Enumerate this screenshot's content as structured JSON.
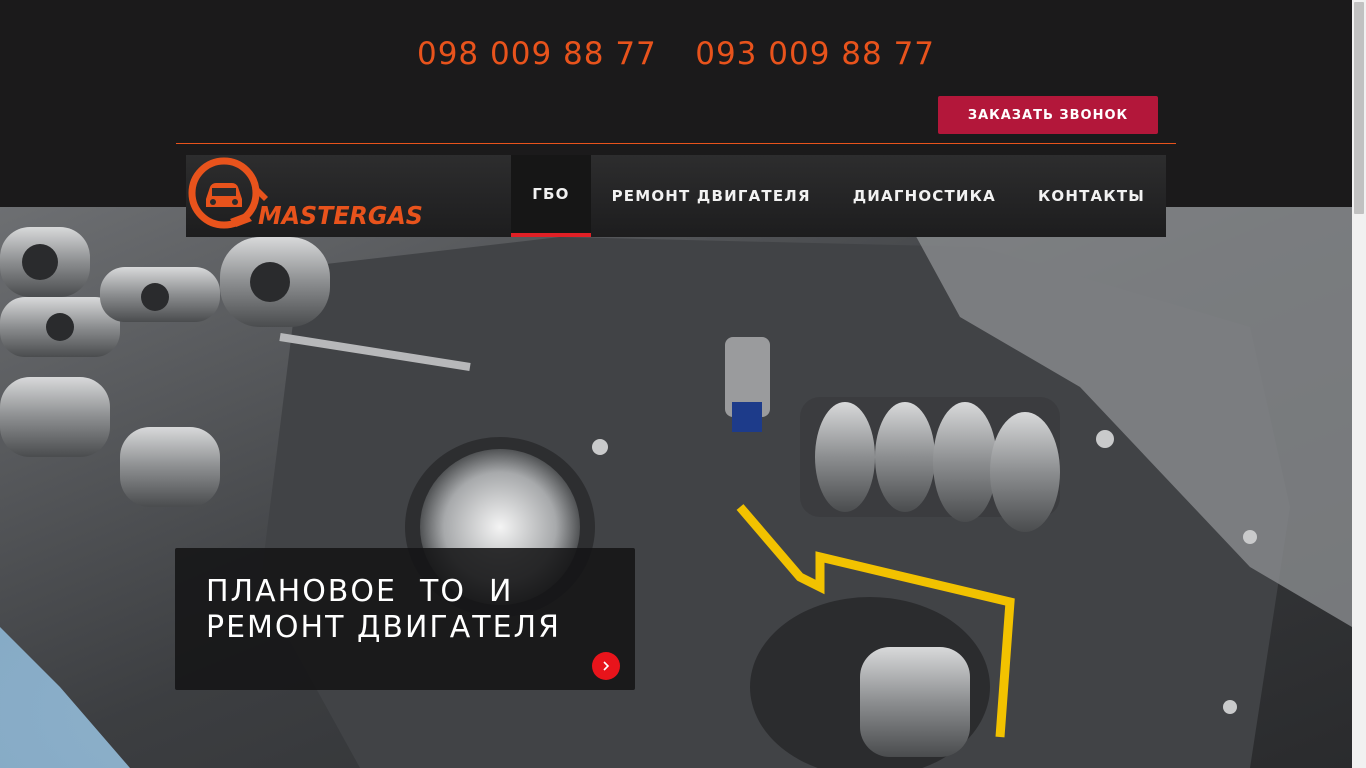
{
  "header": {
    "phones": [
      "098 009 88 77",
      "093 009 88 77"
    ],
    "call_button": "ЗАКАЗАТЬ ЗВОНОК"
  },
  "logo": {
    "text": "MASTERGAS",
    "icon": "car-wrench-icon"
  },
  "nav": {
    "items": [
      {
        "label": "ГБО",
        "active": true
      },
      {
        "label": "РЕМОНТ ДВИГАТЕЛЯ",
        "active": false
      },
      {
        "label": "ДИАГНОСТИКА",
        "active": false
      },
      {
        "label": "КОНТАКТЫ",
        "active": false
      }
    ]
  },
  "slide": {
    "title_line1": "ПЛАНОВОЕ  ТО  И",
    "title_line2": "РЕМОНТ ДВИГАТЕЛЯ",
    "next_icon": "chevron-right-icon"
  },
  "colors": {
    "background": "#1b1a1b",
    "accent_orange": "#e8531c",
    "button_red": "#b3173a",
    "active_underline": "#e02026"
  }
}
